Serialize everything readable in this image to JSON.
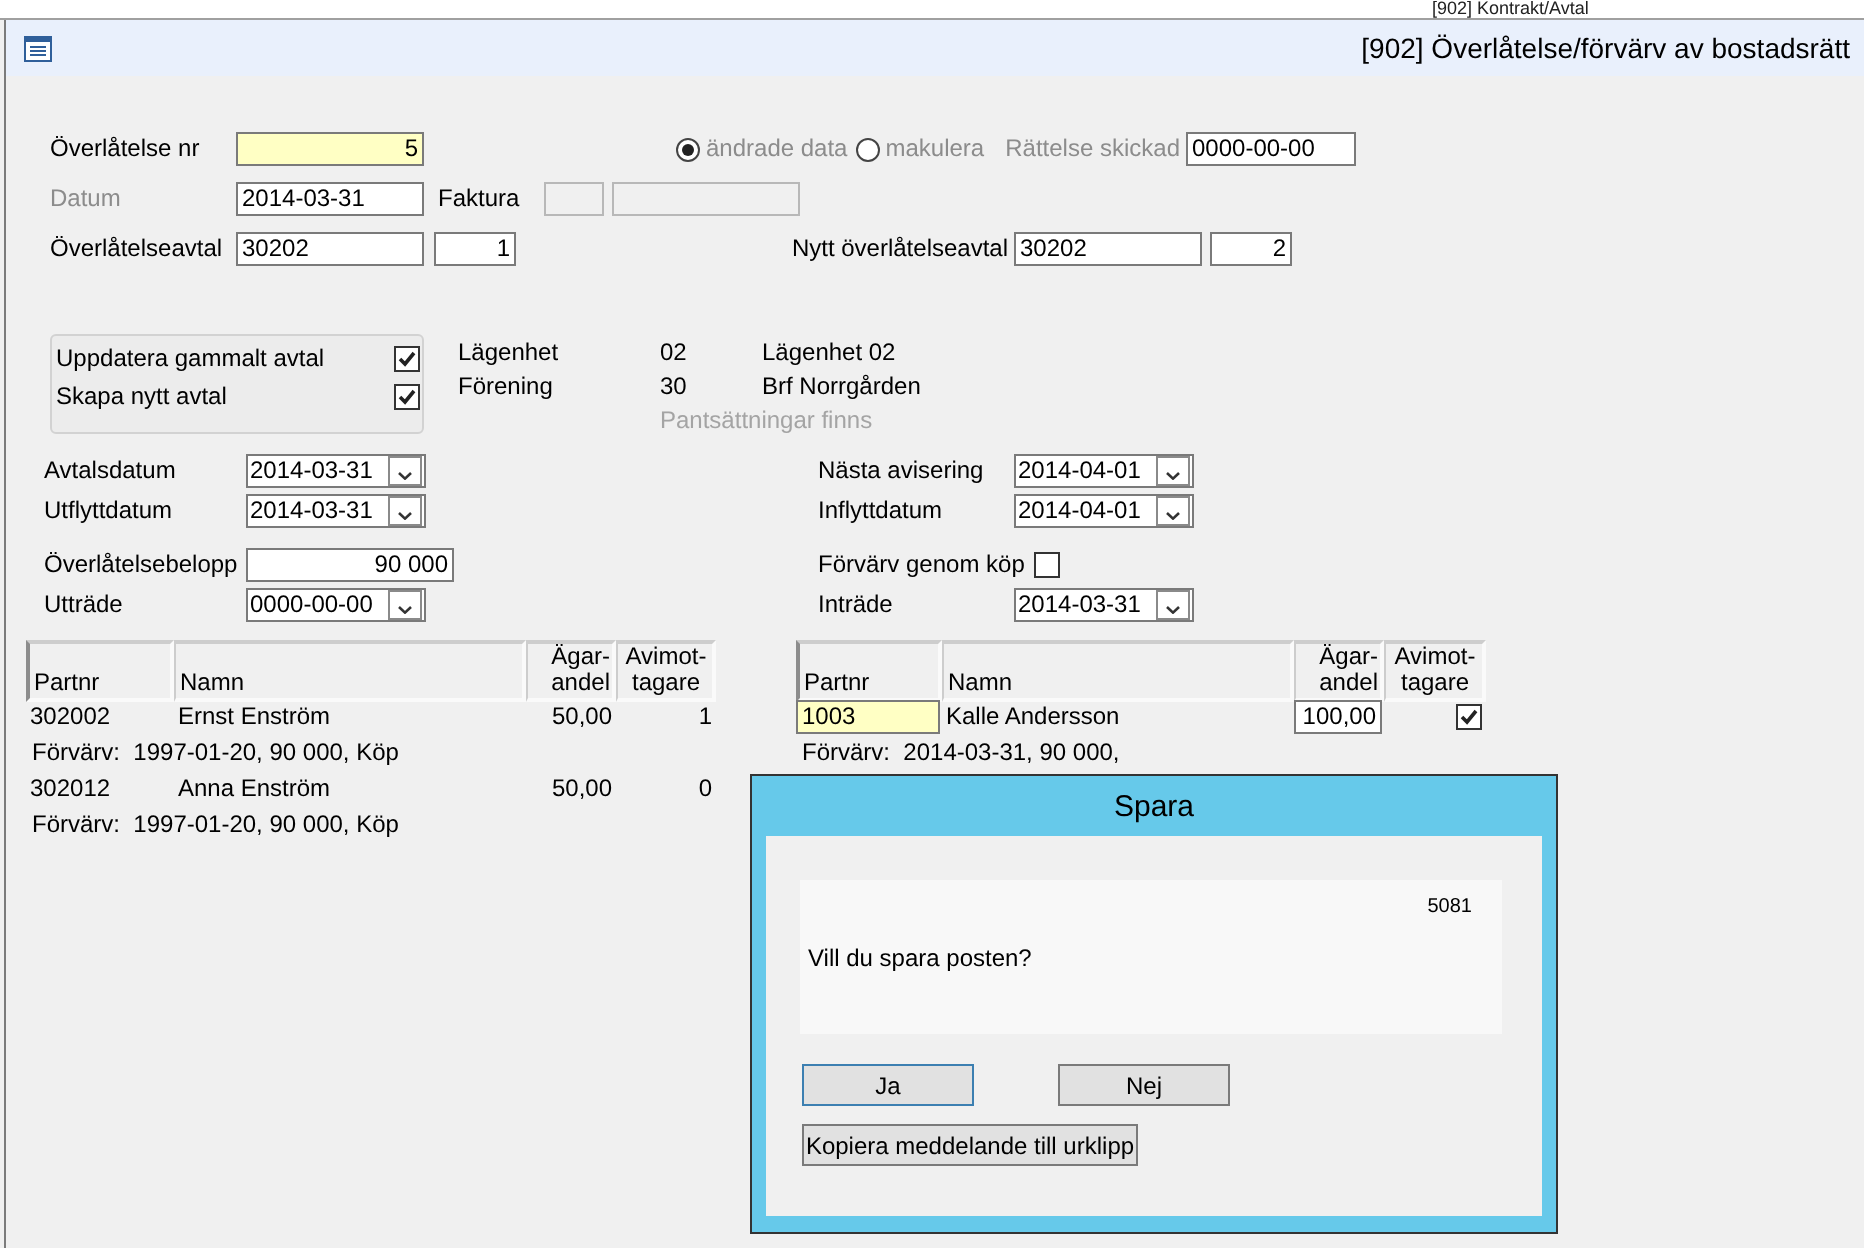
{
  "background_window": {
    "title": "[902]  Kontrakt/Avtal"
  },
  "window": {
    "title": "[902]  Överlåtelse/förvärv av bostadsrätt"
  },
  "transfer_nr": {
    "label": "Överlåtelse nr",
    "value": "5"
  },
  "mode": {
    "disabled": true,
    "options": [
      {
        "label": "ändrade data",
        "selected": true
      },
      {
        "label": "makulera",
        "selected": false
      }
    ]
  },
  "correction_sent": {
    "label": "Rättelse skickad",
    "value": "0000-00-00",
    "disabled": true
  },
  "date": {
    "label": "Datum",
    "value": "2014-03-31",
    "disabled": true
  },
  "invoice": {
    "label": "Faktura"
  },
  "agreement": {
    "label": "Överlåtelseavtal",
    "value": "30202",
    "seq": "1"
  },
  "new_agreement": {
    "label": "Nytt överlåtelseavtal",
    "value": "30202",
    "seq": "2"
  },
  "options": [
    {
      "label": "Uppdatera gammalt avtal",
      "checked": true
    },
    {
      "label": "Skapa nytt avtal",
      "checked": true
    }
  ],
  "apartment_info": [
    {
      "label": "Lägenhet",
      "code": "02",
      "name": "Lägenhet 02"
    },
    {
      "label": "Förening",
      "code": "30",
      "name": "Brf Norrgården"
    }
  ],
  "pledge_note": "Pantsättningar finns",
  "fields_left": [
    {
      "kind": "date",
      "label": "Avtalsdatum",
      "value": "2014-03-31"
    },
    {
      "kind": "date",
      "label": "Utflyttdatum",
      "value": "2014-03-31"
    },
    {
      "kind": "amount",
      "label": "Överlåtelsebelopp",
      "value": "90 000"
    },
    {
      "kind": "date",
      "label": "Utträde",
      "value": "0000-00-00"
    }
  ],
  "fields_right": [
    {
      "kind": "date",
      "label": "Nästa avisering",
      "value": "2014-04-01"
    },
    {
      "kind": "date",
      "label": "Inflyttdatum",
      "value": "2014-04-01"
    },
    {
      "kind": "checkbox",
      "label": "Förvärv genom köp",
      "checked": false
    },
    {
      "kind": "date",
      "label": "Inträde",
      "value": "2014-03-31"
    }
  ],
  "sellers": {
    "columns": [
      [
        "Partnr"
      ],
      [
        "Namn"
      ],
      [
        "Ägar-",
        "andel"
      ],
      [
        "Avimot-",
        "tagare"
      ]
    ],
    "rows": [
      {
        "partnr": "302002",
        "name": "Ernst Enström",
        "share": "50,00",
        "notice_recipient": "1",
        "acquisition": "Förvärv:  1997-01-20, 90 000, Köp"
      },
      {
        "partnr": "302012",
        "name": "Anna Enström",
        "share": "50,00",
        "notice_recipient": "0",
        "acquisition": "Förvärv:  1997-01-20, 90 000, Köp"
      }
    ]
  },
  "buyers": {
    "columns": [
      [
        "Partnr"
      ],
      [
        "Namn"
      ],
      [
        "Ägar-",
        "andel"
      ],
      [
        "Avimot-",
        "tagare"
      ]
    ],
    "rows": [
      {
        "partnr": "1003",
        "name": "Kalle Andersson",
        "share": "100,00",
        "notice_recipient": true,
        "acquisition": "Förvärv:  2014-03-31, 90 000,"
      }
    ]
  },
  "dialog": {
    "title": "Spara",
    "code": "5081",
    "message": "Vill du spara posten?",
    "buttons": [
      {
        "label": "Ja",
        "focused": true
      },
      {
        "label": "Nej",
        "focused": false
      }
    ],
    "copy_button": "Kopiera meddelande till urklipp"
  }
}
